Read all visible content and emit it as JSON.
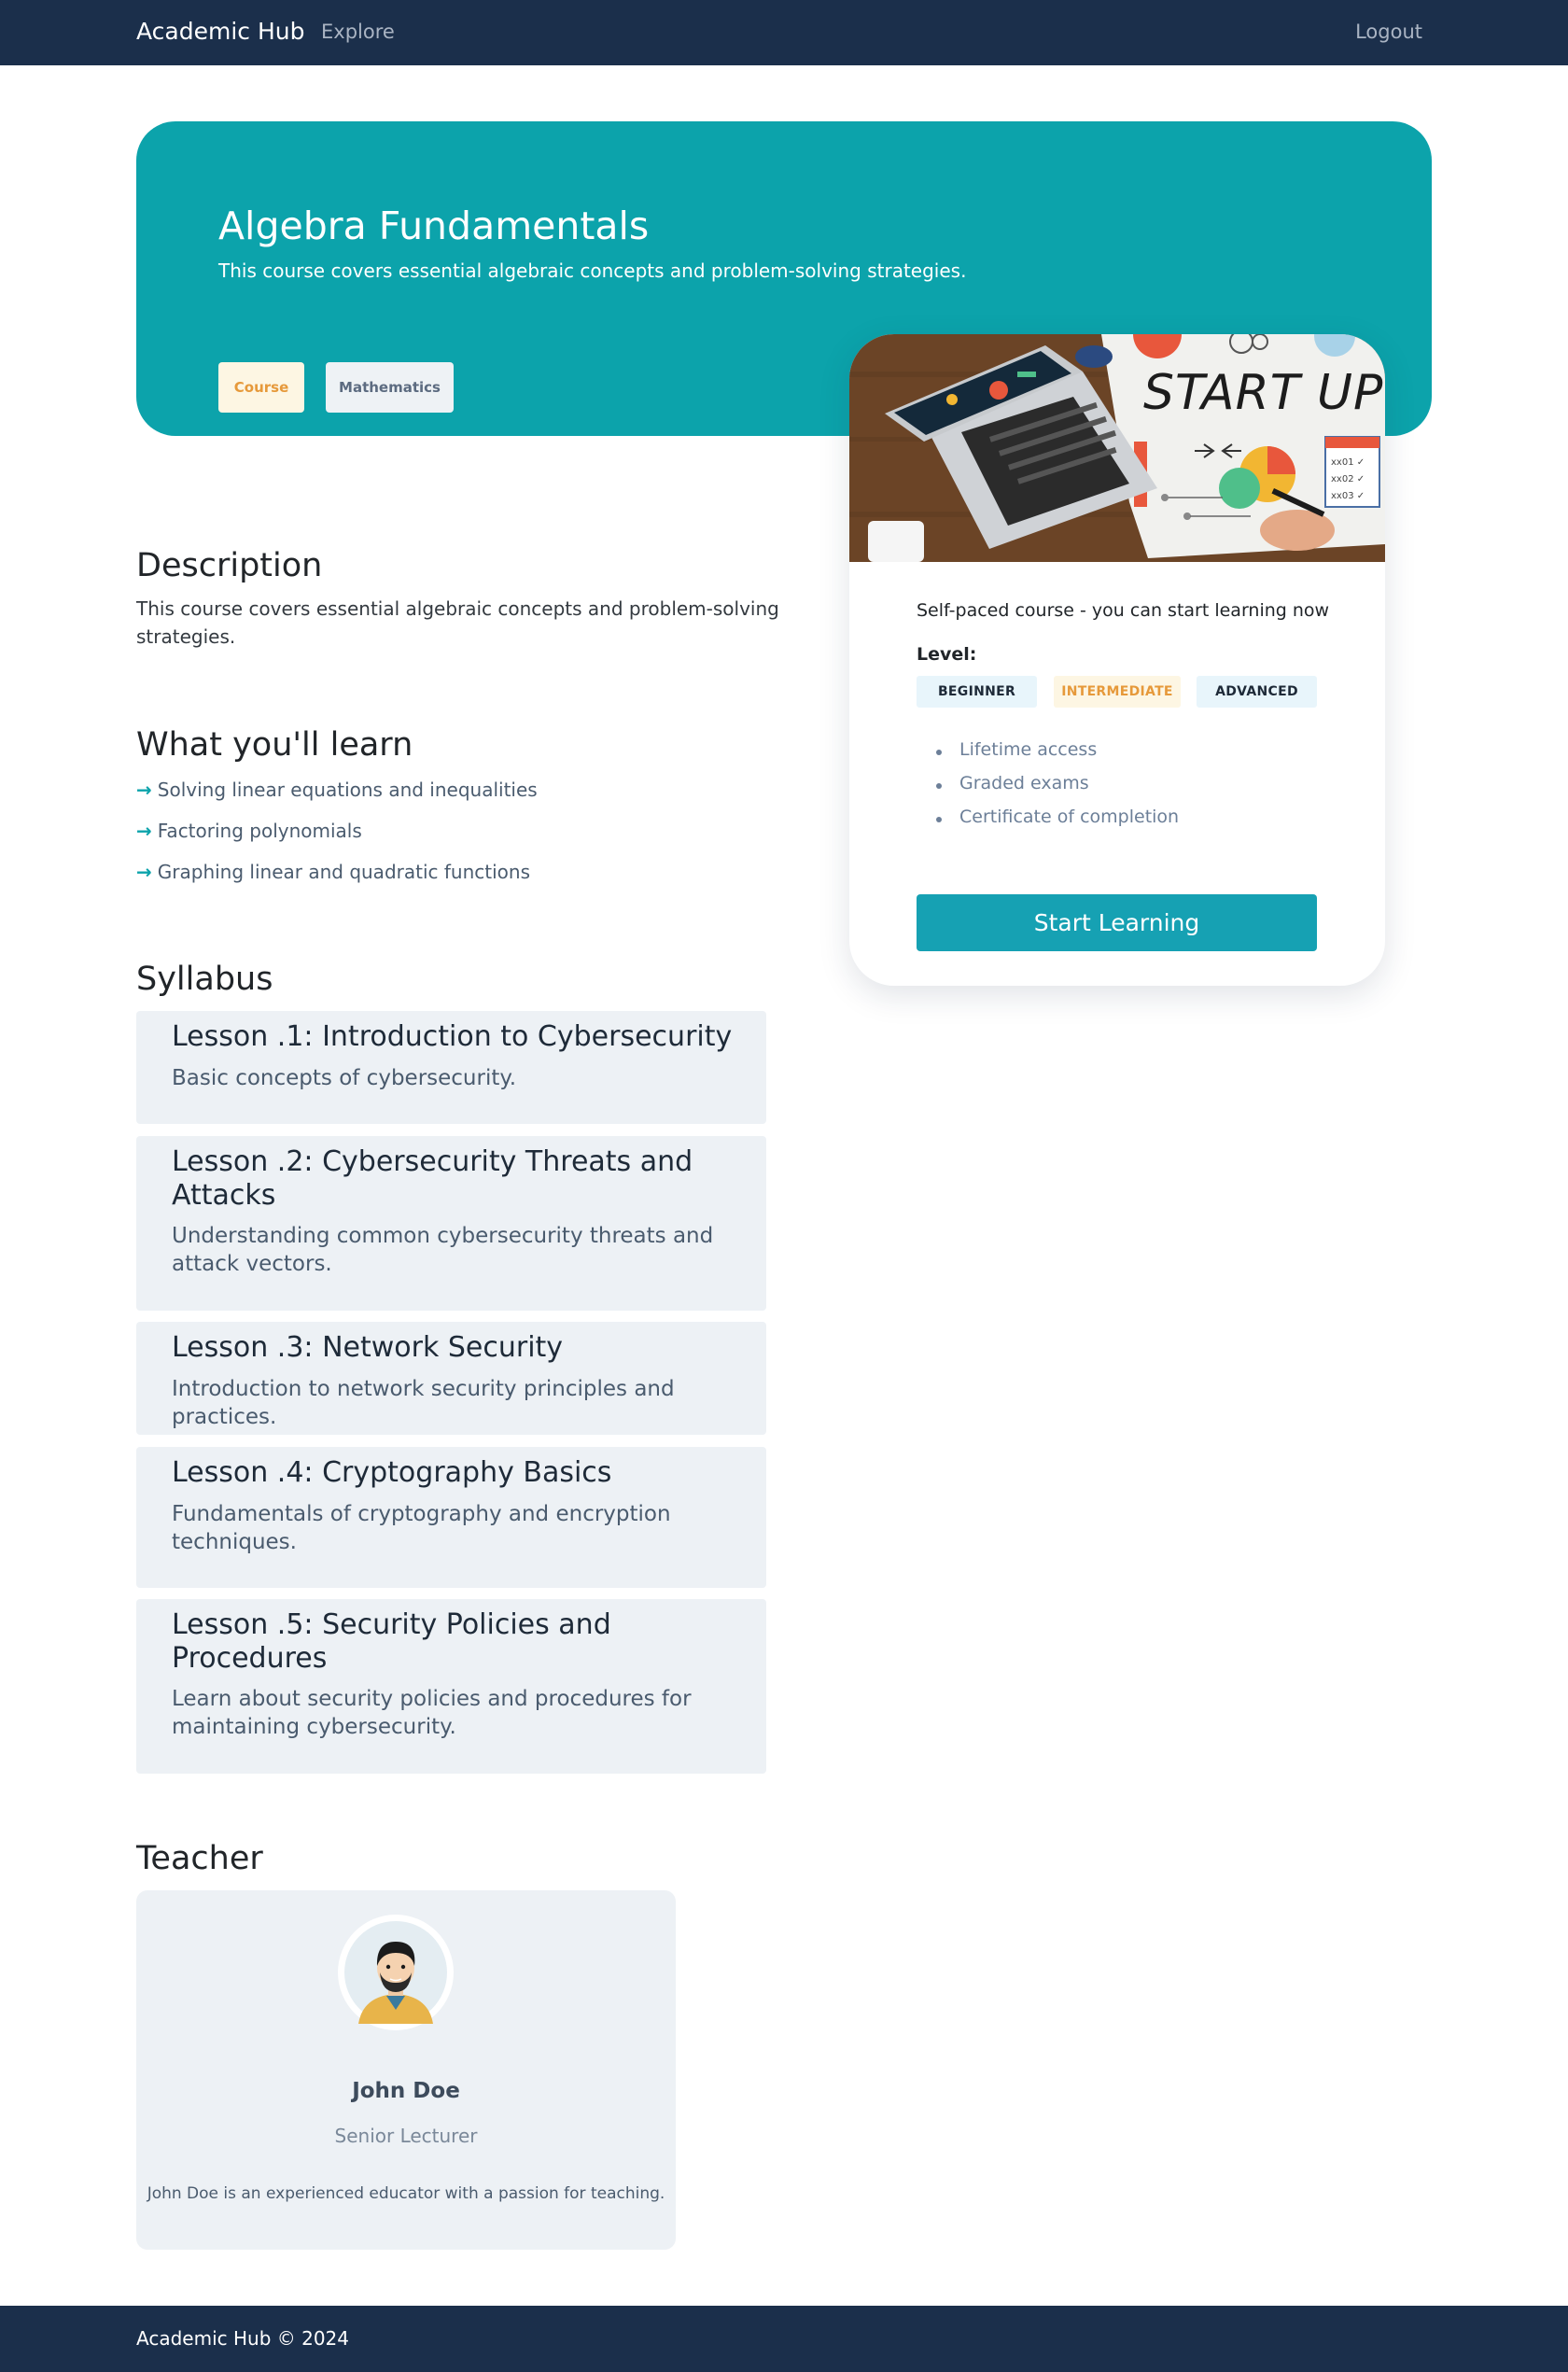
{
  "nav": {
    "brand": "Academic Hub",
    "explore": "Explore",
    "logout": "Logout"
  },
  "hero": {
    "title": "Algebra Fundamentals",
    "subtitle": "This course covers essential algebraic concepts and problem-solving strategies.",
    "tags": [
      "Course",
      "Mathematics"
    ],
    "background_color": "#0ca3ab"
  },
  "card": {
    "image_text": "START UP",
    "availability": "Self-paced course - you can start learning now",
    "level_label": "Level:",
    "levels": [
      "BEGINNER",
      "INTERMEDIATE",
      "ADVANCED"
    ],
    "features": [
      "Lifetime access",
      "Graded exams",
      "Certificate of completion"
    ],
    "cta": "Start Learning",
    "cta_color": "#16a1b3"
  },
  "description": {
    "heading": "Description",
    "text": "This course covers essential algebraic concepts and problem-solving strategies."
  },
  "learn": {
    "heading": "What you'll learn",
    "items": [
      "Solving linear equations and inequalities",
      "Factoring polynomials",
      "Graphing linear and quadratic functions"
    ]
  },
  "syllabus": {
    "heading": "Syllabus",
    "lessons": [
      {
        "title": "Lesson .1: Introduction to Cybersecurity",
        "desc": "Basic concepts of cybersecurity."
      },
      {
        "title": "Lesson .2: Cybersecurity Threats and Attacks",
        "desc": "Understanding common cybersecurity threats and attack vectors."
      },
      {
        "title": "Lesson .3: Network Security",
        "desc": "Introduction to network security principles and practices."
      },
      {
        "title": "Lesson .4: Cryptography Basics",
        "desc": "Fundamentals of cryptography and encryption techniques."
      },
      {
        "title": "Lesson .5: Security Policies and Procedures",
        "desc": "Learn about security policies and procedures for maintaining cybersecurity."
      }
    ]
  },
  "teacher": {
    "heading": "Teacher",
    "name": "John Doe",
    "role": "Senior Lecturer",
    "bio": "John Doe is an experienced educator with a passion for teaching."
  },
  "footer": {
    "text": "Academic Hub © 2024"
  }
}
